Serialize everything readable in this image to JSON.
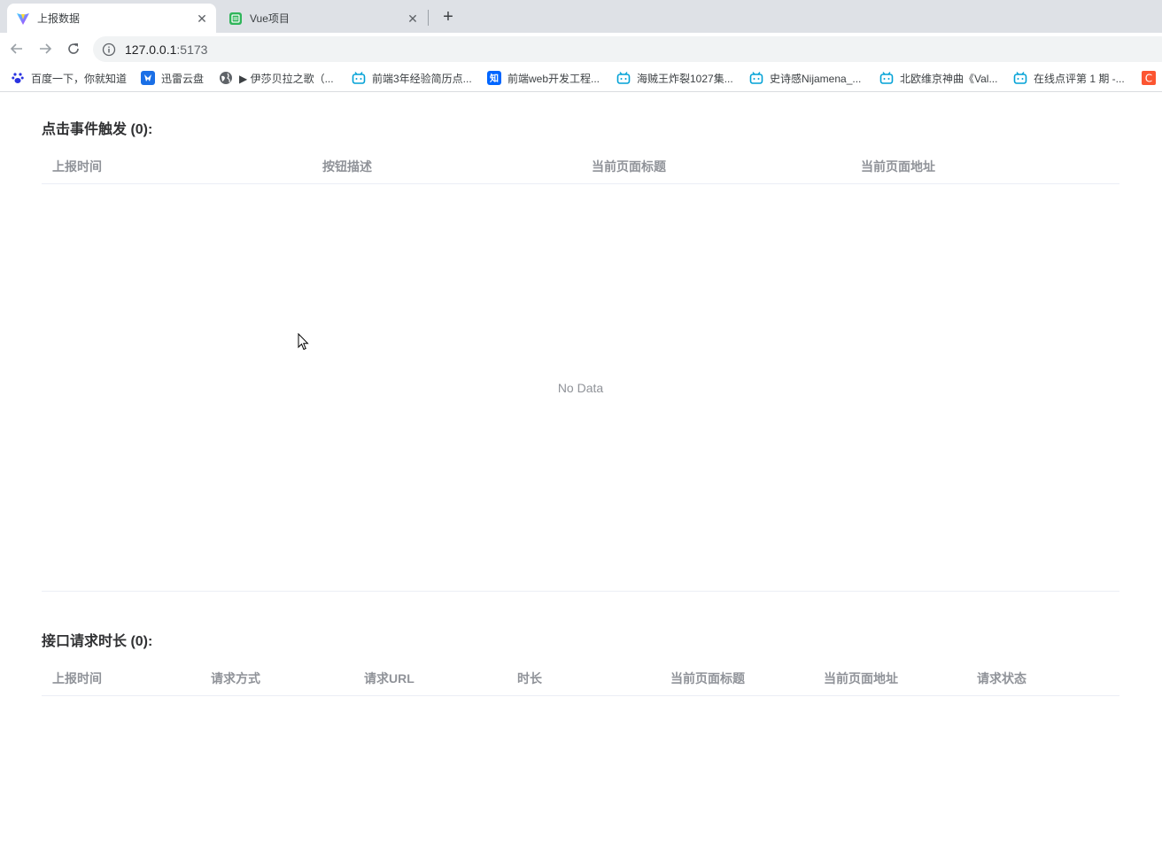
{
  "browser": {
    "tabs": [
      {
        "title": "上报数据",
        "active": true,
        "icon": "vite-icon"
      },
      {
        "title": "Vue项目",
        "active": false,
        "icon": "doc-icon"
      }
    ],
    "new_tab": "+",
    "close": "✕",
    "url": {
      "host": "127.0.0.1",
      "port": ":5173"
    },
    "bookmarks": [
      {
        "label": "百度一下，你就知道",
        "icon": "baidu-paw-icon"
      },
      {
        "label": "迅雷云盘",
        "icon": "xunlei-icon"
      },
      {
        "label": "▶ 伊莎贝拉之歌（...",
        "icon": "globe-icon"
      },
      {
        "label": "前端3年经验简历点...",
        "icon": "bilibili-icon"
      },
      {
        "label": "前端web开发工程...",
        "icon": "zhihu-icon"
      },
      {
        "label": "海贼王炸裂1027集...",
        "icon": "bilibili-icon"
      },
      {
        "label": "史诗感Nijamena_...",
        "icon": "bilibili-icon"
      },
      {
        "label": "北欧维京神曲《Val...",
        "icon": "bilibili-icon"
      },
      {
        "label": "在线点评第 1 期 -...",
        "icon": "bilibili-icon"
      },
      {
        "label": "",
        "icon": "c-icon"
      }
    ]
  },
  "colors": {
    "bilibili": "#00a1d6",
    "zhihu": "#0066ff",
    "xunlei": "#1a6fe6",
    "baidu": "#2932e1",
    "c": "#fc5531"
  },
  "click_section": {
    "title": "点击事件触发 (0):",
    "columns": [
      "上报时间",
      "按钮描述",
      "当前页面标题",
      "当前页面地址"
    ],
    "empty_text": "No Data"
  },
  "request_section": {
    "title": "接口请求时长 (0):",
    "columns": [
      "上报时间",
      "请求方式",
      "请求URL",
      "时长",
      "当前页面标题",
      "当前页面地址",
      "请求状态"
    ]
  }
}
